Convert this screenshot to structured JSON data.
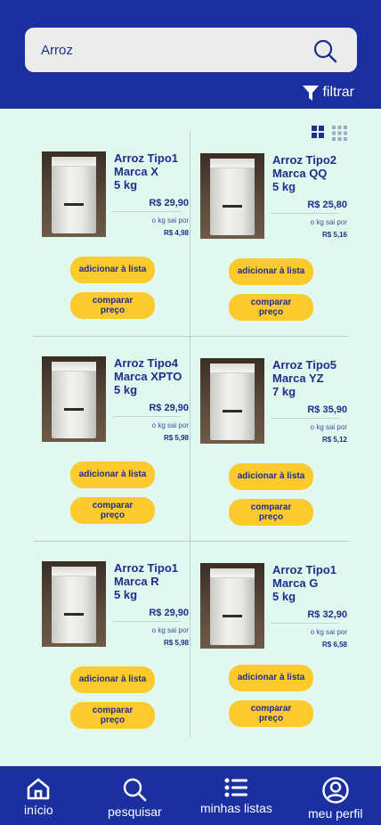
{
  "search": {
    "value": "Arroz"
  },
  "filter": {
    "label": "filtrar"
  },
  "products": [
    {
      "name": "Arroz Tipo1\nMarca X\n5 kg",
      "price": "R$ 29,90",
      "per_kg_label": "o kg sai por",
      "per_kg": "R$ 4,98",
      "add_label": "adicionar à lista",
      "compare_label": "comparar\npreço"
    },
    {
      "name": "Arroz Tipo2\nMarca QQ\n5 kg",
      "price": "R$ 25,80",
      "per_kg_label": "o kg sai por",
      "per_kg": "R$ 5,16",
      "add_label": "adicionar à lista",
      "compare_label": "comparar\npreço"
    },
    {
      "name": "Arroz Tipo4\nMarca XPTO\n5 kg",
      "price": "R$ 29,90",
      "per_kg_label": "o kg sai por",
      "per_kg": "R$ 5,98",
      "add_label": "adicionar à lista",
      "compare_label": "comparar\npreço"
    },
    {
      "name": "Arroz Tipo5\nMarca YZ\n7 kg",
      "price": "R$ 35,90",
      "per_kg_label": "o kg sai por",
      "per_kg": "R$ 5,12",
      "add_label": "adicionar à lista",
      "compare_label": "comparar\npreço"
    },
    {
      "name": "Arroz Tipo1\nMarca R\n5 kg",
      "price": "R$ 29,90",
      "per_kg_label": "o kg sai por",
      "per_kg": "R$ 5,98",
      "add_label": "adicionar à lista",
      "compare_label": "comparar\npreço"
    },
    {
      "name": "Arroz Tipo1\nMarca G\n5 kg",
      "price": "R$ 32,90",
      "per_kg_label": "o kg sai por",
      "per_kg": "R$ 6,58",
      "add_label": "adicionar à lista",
      "compare_label": "comparar\npreço"
    }
  ],
  "nav": [
    {
      "label": "início",
      "icon": "home-icon"
    },
    {
      "label": "pesquisar",
      "icon": "search-icon"
    },
    {
      "label": "minhas listas",
      "icon": "list-icon"
    },
    {
      "label": "meu perfil",
      "icon": "profile-icon"
    }
  ],
  "colors": {
    "primary": "#1a2fa0",
    "accent": "#fdca2e",
    "background": "#e0f8ee",
    "text": "#1d2e8c"
  }
}
